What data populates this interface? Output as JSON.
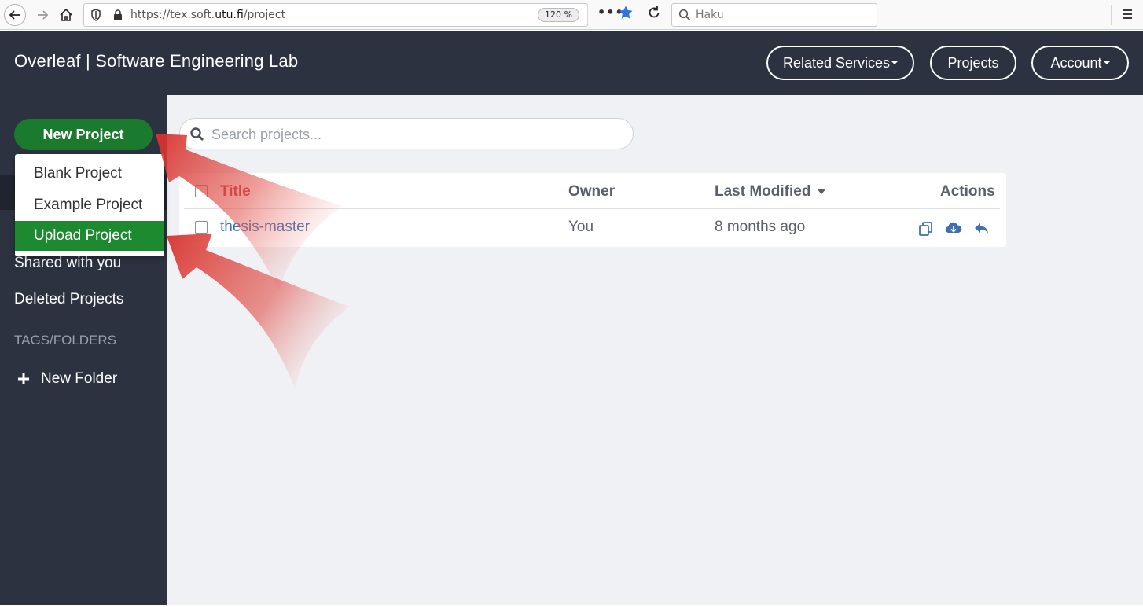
{
  "browser": {
    "url_prefix": "https://tex.soft.",
    "url_domain": "utu.fi",
    "url_path": "/project",
    "zoom": "120 %",
    "search_placeholder": "Haku"
  },
  "header": {
    "brand": "Overleaf | Software Engineering Lab",
    "related_services": "Related Services",
    "projects": "Projects",
    "account": "Account"
  },
  "sidebar": {
    "new_project": "New Project",
    "shared_with_you": "Shared with you",
    "deleted_projects": "Deleted Projects",
    "tags_heading": "TAGS/FOLDERS",
    "new_folder": "New Folder"
  },
  "dropdown": {
    "items": [
      "Blank Project",
      "Example Project",
      "Upload Project"
    ],
    "active_index": 2
  },
  "main": {
    "search_placeholder": "Search projects...",
    "columns": {
      "title": "Title",
      "owner": "Owner",
      "last_modified": "Last Modified",
      "actions": "Actions"
    },
    "rows": [
      {
        "title": "thesis-master",
        "owner": "You",
        "last_modified": "8 months ago"
      }
    ]
  },
  "colors": {
    "header_bg": "#2c3240",
    "primary_green": "#1a7a2e",
    "active_green": "#1d8a2f",
    "link_blue": "#3e70b0",
    "title_red": "#c1443c",
    "arrow_red": "#e0504a"
  }
}
